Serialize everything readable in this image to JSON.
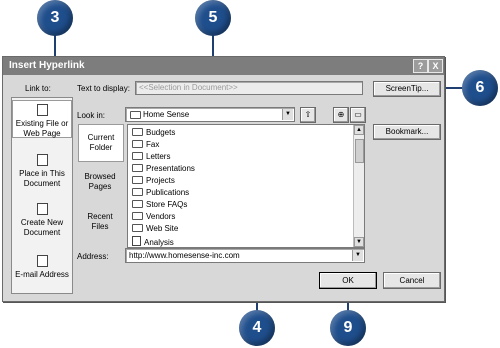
{
  "dialog": {
    "title": "Insert Hyperlink",
    "help_button": "?",
    "close_button": "X"
  },
  "link_to": {
    "label": "Link to:",
    "items": [
      {
        "label": "Existing File or Web Page",
        "selected": true
      },
      {
        "label": "Place in This Document"
      },
      {
        "label": "Create New Document"
      },
      {
        "label": "E-mail Address"
      }
    ]
  },
  "text_to_display": {
    "label": "Text to display:",
    "value": "<<Selection in Document>>"
  },
  "screentip_button": "ScreenTip...",
  "look_in": {
    "label": "Look in:",
    "value": "Home Sense"
  },
  "places": [
    {
      "label": "Current Folder",
      "selected": true
    },
    {
      "label": "Browsed Pages"
    },
    {
      "label": "Recent Files"
    }
  ],
  "file_list": [
    {
      "name": "Budgets"
    },
    {
      "name": "Fax"
    },
    {
      "name": "Letters"
    },
    {
      "name": "Presentations"
    },
    {
      "name": "Projects"
    },
    {
      "name": "Publications"
    },
    {
      "name": "Store FAQs"
    },
    {
      "name": "Vendors"
    },
    {
      "name": "Web Site"
    },
    {
      "name": "Analysis"
    }
  ],
  "bookmark_button": "Bookmark...",
  "address": {
    "label": "Address:",
    "value": "http://www.homesense-inc.com"
  },
  "ok_button": "OK",
  "cancel_button": "Cancel",
  "callouts": [
    "3",
    "5",
    "6",
    "4",
    "9"
  ],
  "colors": {
    "callout": "#1f4e8c",
    "titlebar": "#7d7d7d",
    "dialog": "#d8d8d8"
  }
}
